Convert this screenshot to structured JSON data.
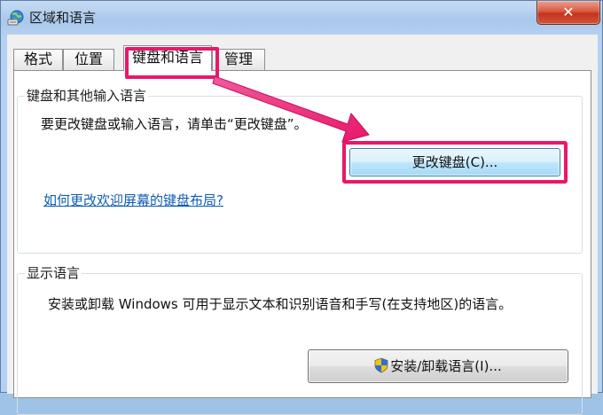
{
  "window": {
    "title": "区域和语言",
    "close_glyph": "✕"
  },
  "tabs": [
    {
      "label": "格式",
      "active": false
    },
    {
      "label": "位置",
      "active": false
    },
    {
      "label": "键盘和语言",
      "active": true
    },
    {
      "label": "管理",
      "active": false
    }
  ],
  "keyboard_group": {
    "title": "键盘和其他输入语言",
    "description": "要更改键盘或输入语言，请单击“更改键盘”。",
    "button_label": "更改键盘(C)...",
    "help_link": "如何更改欢迎屏幕的键盘布局?"
  },
  "display_group": {
    "title": "显示语言",
    "description": "安装或卸载 Windows 可用于显示文本和识别语音和手写(在支持地区)的语言。",
    "button_label": "安装/卸载语言(I)..."
  },
  "colors": {
    "highlight": "#e8186b",
    "link": "#0f5db3",
    "close": "#c2341b"
  },
  "icons": {
    "title": "globe-keyboard-icon",
    "button": "shield-icon",
    "close": "close-icon"
  }
}
